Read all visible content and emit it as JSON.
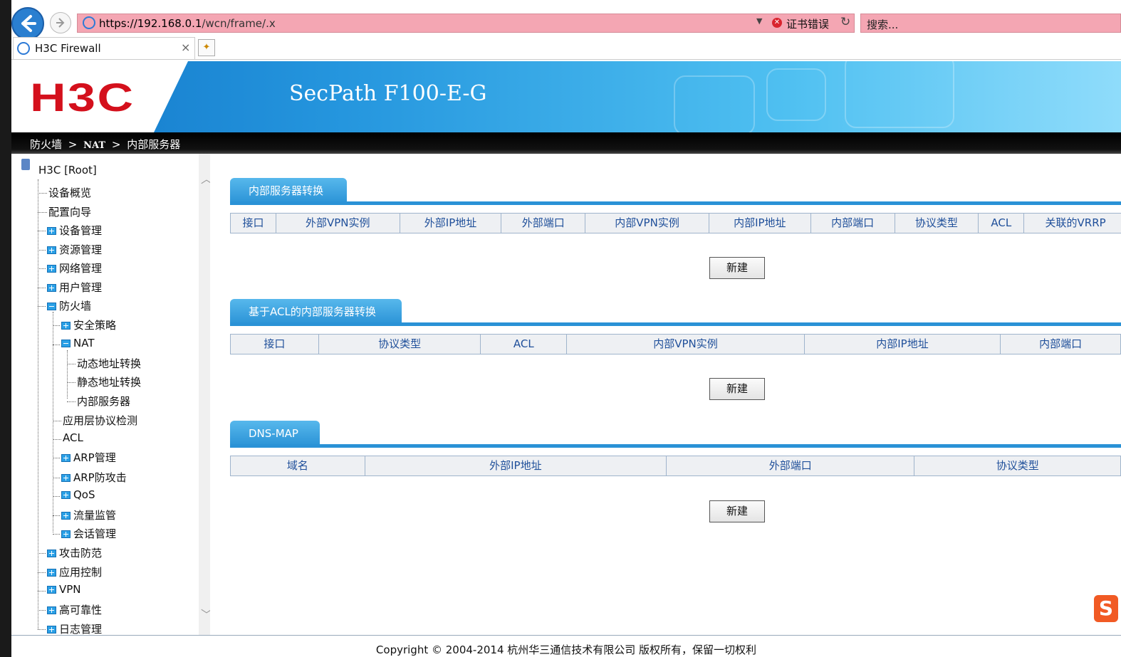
{
  "browser": {
    "url_host": "https://192.168.0.1",
    "url_path": "/wcn/frame/.x",
    "cert_error": "证书错误",
    "search_placeholder": "搜索...",
    "tab_title": "H3C Firewall",
    "tab_close": "×"
  },
  "header": {
    "logo": "H3C",
    "product": "SecPath F100-E-G"
  },
  "breadcrumb": [
    "防火墙",
    ">",
    "NAT",
    ">",
    "内部服务器"
  ],
  "sidebar": {
    "root": "H3C [Root]",
    "items": [
      {
        "label": "设备概览",
        "icon": "none"
      },
      {
        "label": "配置向导",
        "icon": "none"
      },
      {
        "label": "设备管理",
        "icon": "plus"
      },
      {
        "label": "资源管理",
        "icon": "plus"
      },
      {
        "label": "网络管理",
        "icon": "plus"
      },
      {
        "label": "用户管理",
        "icon": "plus"
      },
      {
        "label": "防火墙",
        "icon": "minus"
      },
      {
        "label": "安全策略",
        "icon": "plus"
      },
      {
        "label": "NAT",
        "icon": "minus"
      },
      {
        "label": "动态地址转换",
        "icon": "none"
      },
      {
        "label": "静态地址转换",
        "icon": "none"
      },
      {
        "label": "内部服务器",
        "icon": "none"
      },
      {
        "label": "应用层协议检测",
        "icon": "none"
      },
      {
        "label": "ACL",
        "icon": "none"
      },
      {
        "label": "ARP管理",
        "icon": "plus"
      },
      {
        "label": "ARP防攻击",
        "icon": "plus"
      },
      {
        "label": "QoS",
        "icon": "plus"
      },
      {
        "label": "流量监管",
        "icon": "plus"
      },
      {
        "label": "会话管理",
        "icon": "plus"
      },
      {
        "label": "攻击防范",
        "icon": "plus"
      },
      {
        "label": "应用控制",
        "icon": "plus"
      },
      {
        "label": "VPN",
        "icon": "plus"
      },
      {
        "label": "高可靠性",
        "icon": "plus"
      },
      {
        "label": "日志管理",
        "icon": "plus"
      }
    ]
  },
  "sections": [
    {
      "title": "内部服务器转换",
      "columns": [
        "接口",
        "外部VPN实例",
        "外部IP地址",
        "外部端口",
        "内部VPN实例",
        "内部IP地址",
        "内部端口",
        "协议类型",
        "ACL",
        "关联的VRRP"
      ],
      "button": "新建"
    },
    {
      "title": "基于ACL的内部服务器转换",
      "columns": [
        "接口",
        "协议类型",
        "ACL",
        "内部VPN实例",
        "内部IP地址",
        "内部端口"
      ],
      "button": "新建"
    },
    {
      "title": "DNS-MAP",
      "columns": [
        "域名",
        "外部IP地址",
        "外部端口",
        "协议类型"
      ],
      "button": "新建"
    }
  ],
  "footer": {
    "copyright": "Copyright © 2004-2014 杭州华三通信技术有限公司 版权所有，保留一切权利"
  },
  "colors": {
    "accent_blue": "#2a92d6",
    "brand_red": "#d4101c",
    "address_bar_error": "#f4a6b3"
  }
}
